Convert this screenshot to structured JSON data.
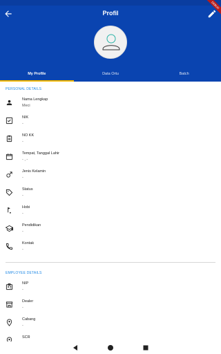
{
  "header": {
    "title": "Profil"
  },
  "debug_banner": "DEBUG",
  "tabs": [
    {
      "label": "My Profile",
      "active": true
    },
    {
      "label": "Data Ortu",
      "active": false
    },
    {
      "label": "Batch",
      "active": false
    }
  ],
  "personal": {
    "title": "PERSONAL DETAILS",
    "items": [
      {
        "icon": "person-icon",
        "label": "Nama Lengkap",
        "value": "Meci"
      },
      {
        "icon": "id-card-icon",
        "label": "NIK",
        "value": "-"
      },
      {
        "icon": "clipboard-icon",
        "label": "NO KK",
        "value": "-"
      },
      {
        "icon": "calendar-icon",
        "label": "Tempat, Tanggal Lahir",
        "value": "- , -"
      },
      {
        "icon": "male-icon",
        "label": "Jenis Kelamin",
        "value": "-"
      },
      {
        "icon": "tag-icon",
        "label": "Status",
        "value": "-"
      },
      {
        "icon": "golf-icon",
        "label": "Hobi",
        "value": "-"
      },
      {
        "icon": "school-icon",
        "label": "Pendidikan",
        "value": "-"
      },
      {
        "icon": "phone-icon",
        "label": "Kontak",
        "value": "-"
      }
    ]
  },
  "employee": {
    "title": "EMPLOYEE DETAILS",
    "items": [
      {
        "icon": "badge-icon",
        "label": "NIP",
        "value": "-"
      },
      {
        "icon": "store-icon",
        "label": "Dealer",
        "value": "-"
      },
      {
        "icon": "location-icon",
        "label": "Cabang",
        "value": "-"
      },
      {
        "icon": "location-icon",
        "label": "SCR",
        "value": "-"
      }
    ]
  },
  "colors": {
    "primary": "#0a44b0",
    "accent": "#f5b800",
    "section": "#1e88e5"
  }
}
